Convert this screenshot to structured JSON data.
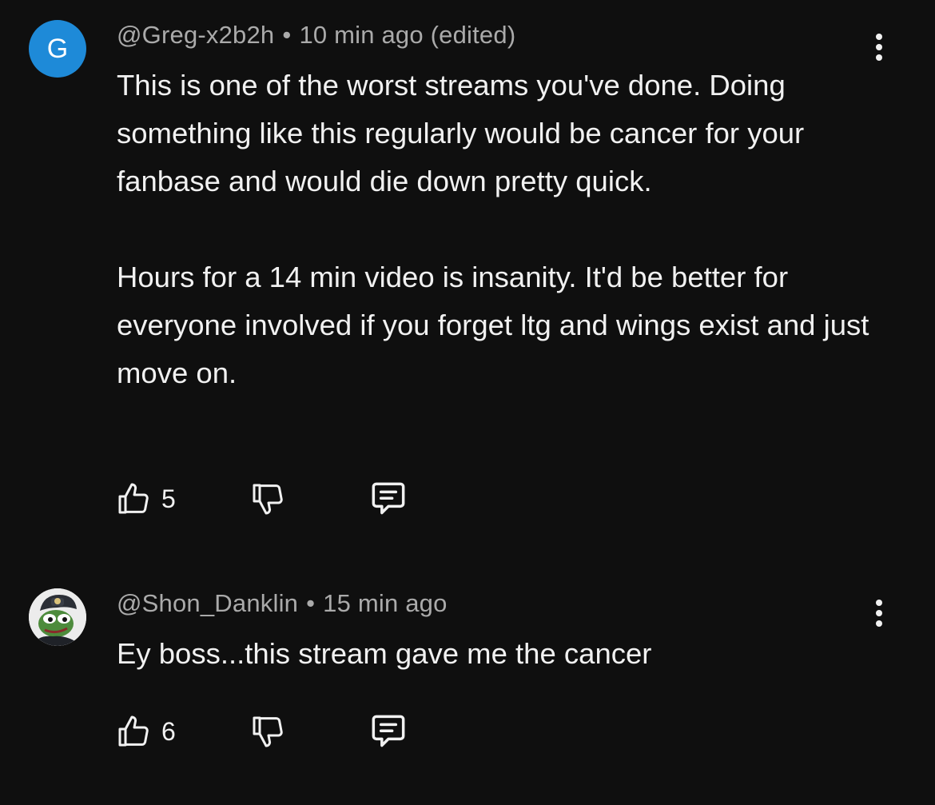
{
  "comments": [
    {
      "avatar_letter": "G",
      "avatar_color": "#1e8ad8",
      "username": "@Greg-x2b2h",
      "separator": "•",
      "time": "10 min ago (edited)",
      "paragraphs": [
        "This is one of the worst streams you've done. Doing something like this regularly would be cancer for your fanbase and would die down pretty quick.",
        "Hours for a 14 min video is insanity. It'd be better for everyone involved if you forget ltg and wings exist and just move on."
      ],
      "likes": "5",
      "icons": {
        "like": "thumbs-up-icon",
        "dislike": "thumbs-down-icon",
        "reply": "reply-comment-icon",
        "more": "more-vertical-icon"
      }
    },
    {
      "avatar_image": "pepe-frog-avatar",
      "username": "@Shon_Danklin",
      "separator": "•",
      "time": "15 min ago",
      "paragraphs": [
        "Ey boss...this stream gave me the cancer"
      ],
      "likes": "6",
      "icons": {
        "like": "thumbs-up-icon",
        "dislike": "thumbs-down-icon",
        "reply": "reply-comment-icon",
        "more": "more-vertical-icon"
      }
    }
  ],
  "theme": {
    "background": "#0f0f0f",
    "text": "#f1f1f1",
    "meta_text": "#aaaaaa"
  }
}
